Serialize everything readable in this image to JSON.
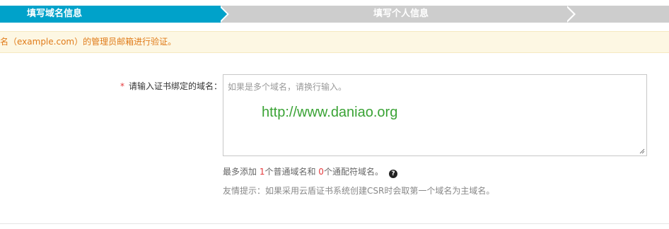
{
  "steps": [
    {
      "label": "填写域名信息",
      "active": true
    },
    {
      "label": "填写个人信息",
      "active": false
    }
  ],
  "notice": {
    "text": "名（example.com）的管理员邮箱进行验证。"
  },
  "form": {
    "domain_field": {
      "required_mark": "*",
      "label": "请输入证书绑定的域名：",
      "placeholder": "如果是多个域名，请换行输入。",
      "value": "http://www.daniao.org"
    },
    "limit_hint": {
      "prefix": "最多添加 ",
      "normal_count": "1",
      "middle": "个普通域名和 ",
      "wildcard_count": "0",
      "suffix": "个通配符域名。"
    },
    "help_icon": "question-circle-icon",
    "tip": "友情提示：如果采用云盾证书系统创建CSR时会取第一个域名为主域名。"
  },
  "colors": {
    "active_step": "#00a2ca",
    "inactive_step": "#cdcdcd",
    "notice_bg": "#fdf7e3",
    "notice_text": "#e07b19",
    "required": "#e4393c",
    "watermark": "#3aa335"
  }
}
